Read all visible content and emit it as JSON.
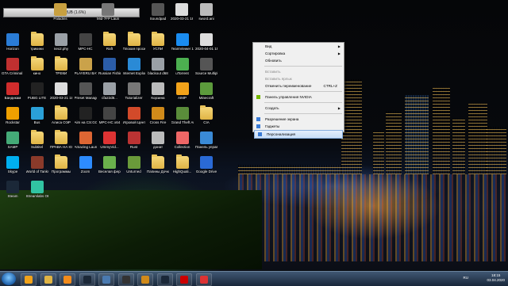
{
  "topbar": {
    "label": "112 RUB (1.6%)"
  },
  "desktop_icons": [
    {
      "label": "Horizon",
      "icon": "app-icon",
      "color": "#2a7cd6"
    },
    {
      "label": "трикини",
      "icon": "folder-icon",
      "color": "#e0b445"
    },
    {
      "label": "nex2.phy",
      "icon": "file-icon",
      "color": "#9aa0a6"
    },
    {
      "label": "MPC-HC",
      "icon": "app-icon",
      "color": "#444"
    },
    {
      "label": "Raft",
      "icon": "folder-icon",
      "color": "#e0b445"
    },
    {
      "label": "Плохая просит",
      "icon": "folder-icon",
      "color": "#e0b445"
    },
    {
      "label": "УСПИ",
      "icon": "folder-icon",
      "color": "#e0b445"
    },
    {
      "label": "TeamViewer 13",
      "icon": "teamviewer-icon",
      "color": "#1a8cf0"
    },
    {
      "label": "2020-04-01 15-2...",
      "icon": "image-icon",
      "color": "#ddd"
    },
    {
      "label": "GTA Criminal Russia",
      "icon": "app-icon",
      "color": "#c03030"
    },
    {
      "label": "кино",
      "icon": "folder-icon",
      "color": "#e0b445"
    },
    {
      "label": "ТРЕКИ",
      "icon": "folder-icon",
      "color": "#e0b445"
    },
    {
      "label": "PLAYERU BATTLEGR...",
      "icon": "app-icon",
      "color": "#caa24a"
    },
    {
      "label": "Russian Fishing 4",
      "icon": "app-icon",
      "color": "#2b5da8"
    },
    {
      "label": "Internet Explorer",
      "icon": "ie-icon",
      "color": "#2a8ad6"
    },
    {
      "label": "blackout d68",
      "icon": "file-icon",
      "color": "#9aa0a6"
    },
    {
      "label": "uTorrent",
      "icon": "utorrent-icon",
      "color": "#4caf50"
    },
    {
      "label": "Source Multiplayer",
      "icon": "app-icon",
      "color": "#555"
    },
    {
      "label": "Бандикам",
      "icon": "bandicam-icon",
      "color": "#d02c2c"
    },
    {
      "label": "PUBG LITE",
      "icon": "app-icon",
      "color": "#222"
    },
    {
      "label": "2020-03-21 18-27-29.m...",
      "icon": "image-icon",
      "color": "#ddd"
    },
    {
      "label": "Preset Manager 1.0",
      "icon": "app-icon",
      "color": "#555"
    },
    {
      "label": "cfa22d8...",
      "icon": "file-icon",
      "color": "#9aa0a6"
    },
    {
      "label": "Tutorializer",
      "icon": "app-icon",
      "color": "#777"
    },
    {
      "label": "Корзина",
      "icon": "trash-icon",
      "color": "#bbb"
    },
    {
      "label": "AIMP",
      "icon": "aimp-icon",
      "color": "#f2a31a"
    },
    {
      "label": "Minecraft",
      "icon": "app-icon",
      "color": "#5c9b3c"
    },
    {
      "label": "Rockstar",
      "icon": "app-icon",
      "color": "#f0a000"
    },
    {
      "label": "Bus",
      "icon": "app-icon",
      "color": "#2aa0d8"
    },
    {
      "label": "Алиса ОЭР",
      "icon": "folder-icon",
      "color": "#e0b445"
    },
    {
      "label": "Aim на CS:GO",
      "icon": "app-icon",
      "color": "#222"
    },
    {
      "label": "MPC-HC x64",
      "icon": "app-icon",
      "color": "#444"
    },
    {
      "label": "Игровой Центр",
      "icon": "app-icon",
      "color": "#d24a2a"
    },
    {
      "label": "Cross Fire",
      "icon": "app-icon",
      "color": "#d08a1a"
    },
    {
      "label": "Grand Theft Auto V",
      "icon": "app-icon",
      "color": "#5a8c3a"
    },
    {
      "label": "CIA",
      "icon": "folder-icon",
      "color": "#e0b445"
    },
    {
      "label": "SAMP",
      "icon": "app-icon",
      "color": "#4a7"
    },
    {
      "label": "Subtitel",
      "icon": "folder-icon",
      "color": "#e0b445"
    },
    {
      "label": "ПРАВА НА ЮТУБ",
      "icon": "folder-icon",
      "color": "#e0b445"
    },
    {
      "label": "Amazing Launcher",
      "icon": "app-icon",
      "color": "#d63"
    },
    {
      "label": "UmmyVid...",
      "icon": "app-icon",
      "color": "#d33"
    },
    {
      "label": "Rust",
      "icon": "app-icon",
      "color": "#b33"
    },
    {
      "label": "донат",
      "icon": "file-icon",
      "color": "#bbb"
    },
    {
      "label": "Collection",
      "icon": "app-icon",
      "color": "#e66"
    },
    {
      "label": "Панель управления",
      "icon": "control-panel-icon",
      "color": "#3a8ad6"
    },
    {
      "label": "Skype",
      "icon": "skype-icon",
      "color": "#00aff0"
    },
    {
      "label": "World of Tanks",
      "icon": "app-icon",
      "color": "#8a3a2a"
    },
    {
      "label": "Программы",
      "icon": "folder-icon",
      "color": "#e0b445"
    },
    {
      "label": "Zoom",
      "icon": "zoom-icon",
      "color": "#2d8cff"
    },
    {
      "label": "Веселая ферма 3",
      "icon": "app-icon",
      "color": "#6ab04c"
    },
    {
      "label": "Unturned",
      "icon": "app-icon",
      "color": "#6a9a3a"
    },
    {
      "label": "Папины Дочки",
      "icon": "folder-icon",
      "color": "#e0b445"
    },
    {
      "label": "HighQuali...",
      "icon": "folder-icon",
      "color": "#e0b445"
    },
    {
      "label": "Google Drive",
      "icon": "app-icon",
      "color": "#2a6ad6"
    },
    {
      "label": "Steam",
      "icon": "steam-icon",
      "color": "#1b2838"
    },
    {
      "label": "Streamlabs OBS",
      "icon": "obs-icon",
      "color": "#31c3a2"
    }
  ],
  "top_row_icons": [
    {
      "label": "Paladins",
      "icon": "app-icon",
      "color": "#c8a040"
    },
    {
      "label": "Mid-7FP Launcher",
      "icon": "app-icon",
      "color": "#777"
    },
    {
      "label": "Soundpad",
      "icon": "app-icon",
      "color": "#555"
    },
    {
      "label": "2020-03-21 18-27-29.m...",
      "icon": "image-icon",
      "color": "#ddd"
    },
    {
      "label": "sword.ani",
      "icon": "file-icon",
      "color": "#bbb"
    }
  ],
  "context_menu": {
    "items": [
      {
        "label": "Вид",
        "type": "submenu",
        "enabled": true
      },
      {
        "label": "Сортировка",
        "type": "submenu",
        "enabled": true
      },
      {
        "label": "Обновить",
        "type": "item",
        "enabled": true
      },
      {
        "type": "separator"
      },
      {
        "label": "Вставить",
        "type": "item",
        "enabled": false
      },
      {
        "label": "Вставить ярлык",
        "type": "item",
        "enabled": false
      },
      {
        "label": "Отменить переименование",
        "type": "item",
        "enabled": true,
        "shortcut": "CTRL+Z"
      },
      {
        "type": "separator"
      },
      {
        "label": "Панель управления NVIDIA",
        "type": "item",
        "enabled": true,
        "icon": "nvidia-icon"
      },
      {
        "type": "separator"
      },
      {
        "label": "Создать",
        "type": "submenu",
        "enabled": true
      },
      {
        "type": "separator"
      },
      {
        "label": "Разрешение экрана",
        "type": "item",
        "enabled": true,
        "icon": "display-icon"
      },
      {
        "label": "Гаджеты",
        "type": "item",
        "enabled": true,
        "icon": "gadgets-icon"
      },
      {
        "label": "Персонализация",
        "type": "item",
        "enabled": true,
        "icon": "personalize-icon",
        "hover": true
      }
    ]
  },
  "taskbar": {
    "pinned": [
      {
        "name": "aimp-icon",
        "color": "#f2a31a"
      },
      {
        "name": "explorer-icon",
        "color": "#e0b445"
      },
      {
        "name": "media-player-icon",
        "color": "#f38b1b"
      },
      {
        "name": "steam-icon",
        "color": "#1b2838"
      },
      {
        "name": "vegas-icon",
        "color": "#4a7ab0"
      },
      {
        "name": "csgo-icon",
        "color": "#333"
      },
      {
        "name": "game-icon",
        "color": "#d08a1a"
      },
      {
        "name": "steam-icon",
        "color": "#1b2838"
      },
      {
        "name": "opera-icon",
        "color": "#c00"
      },
      {
        "name": "yandex-icon",
        "color": "#d33"
      }
    ],
    "lang": "RU",
    "time": "18:15",
    "date": "03.04.2020"
  }
}
